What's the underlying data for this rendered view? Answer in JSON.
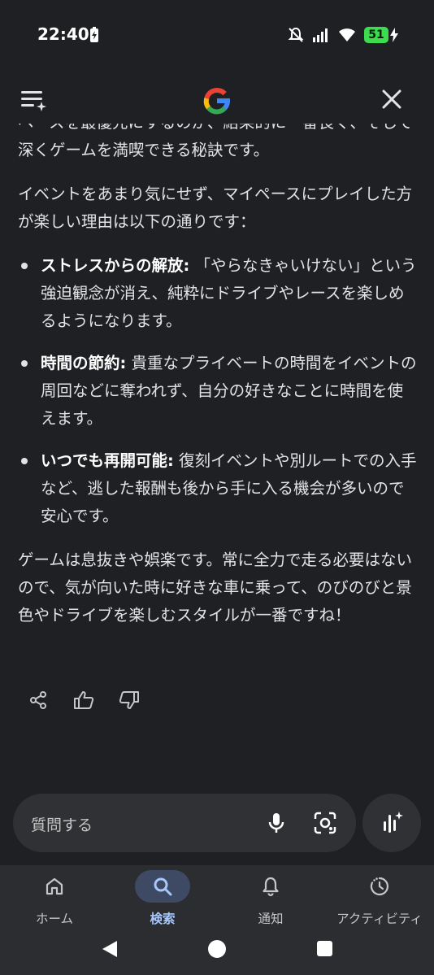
{
  "status_bar": {
    "time": "22:40",
    "battery": "51",
    "icons": [
      "mute-icon",
      "signal-icon",
      "wifi-icon",
      "battery-charging-icon"
    ]
  },
  "header": {
    "menu_icon": "menu-sparkle-icon",
    "logo": "G",
    "close_icon": "close-icon"
  },
  "content": {
    "partial_line": "ペースを最優先にするのが、結果的に一番長く、そして深くゲームを満喫できる秘訣です。",
    "intro": "イベントをあまり気にせず、マイペースにプレイした方が楽しい理由は以下の通りです：",
    "bullets": [
      {
        "title": "ストレスからの解放:",
        "text": "「やらなきゃいけない」という強迫観念が消え、純粋にドライブやレースを楽しめるようになります。"
      },
      {
        "title": "時間の節約:",
        "text": "貴重なプライベートの時間をイベントの周回などに奪われず、自分の好きなことに時間を使えます。"
      },
      {
        "title": "いつでも再開可能:",
        "text": "復刻イベントや別ルートでの入手など、逃した報酬も後から手に入る機会が多いので安心です。"
      }
    ],
    "closing": "ゲームは息抜きや娯楽です。常に全力で走る必要はないので、気が向いた時に好きな車に乗って、のびのびと景色やドライブを楽しむスタイルが一番ですね！"
  },
  "feedback": {
    "icons": [
      "share-icon",
      "thumbs-up-icon",
      "thumbs-down-icon"
    ]
  },
  "input": {
    "placeholder": "質問する"
  },
  "bottom_nav": {
    "items": [
      {
        "label": "ホーム",
        "icon": "home-icon"
      },
      {
        "label": "検索",
        "icon": "search-icon",
        "active": true
      },
      {
        "label": "通知",
        "icon": "bell-icon"
      },
      {
        "label": "アクティビティ",
        "icon": "activity-icon"
      }
    ]
  },
  "colors": {
    "background": "#1f2023",
    "nav_background": "#2b2d31",
    "active_accent": "#a8c7fa",
    "active_pill": "#3e4a64"
  }
}
